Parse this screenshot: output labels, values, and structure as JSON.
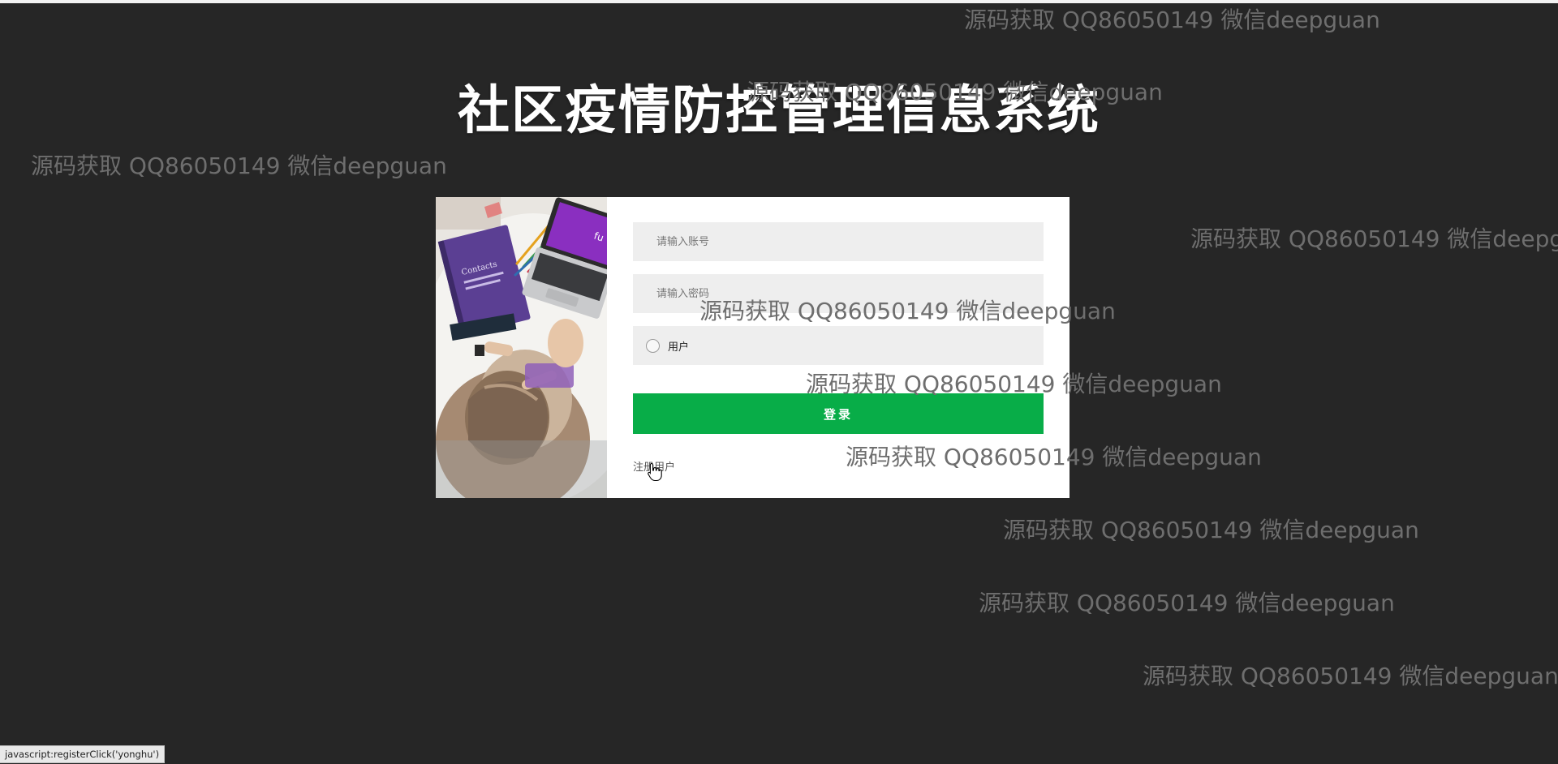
{
  "page": {
    "title": "社区疫情防控管理信息系统"
  },
  "login_form": {
    "username_placeholder": "请输入账号",
    "password_placeholder": "请输入密码",
    "role_option": "用户",
    "login_button": "登录",
    "register_link": "注册用户"
  },
  "watermark": {
    "text": "源码获取 QQ86050149 微信deepguan"
  },
  "status_bar": {
    "text": "javascript:registerClick('yonghu')"
  },
  "colors": {
    "background": "#262626",
    "accent_green": "#08ad48",
    "watermark": "#6e6e6e"
  },
  "icons": {
    "role_radio": "radio-unchecked-icon",
    "cursor": "hand-pointer-icon"
  }
}
